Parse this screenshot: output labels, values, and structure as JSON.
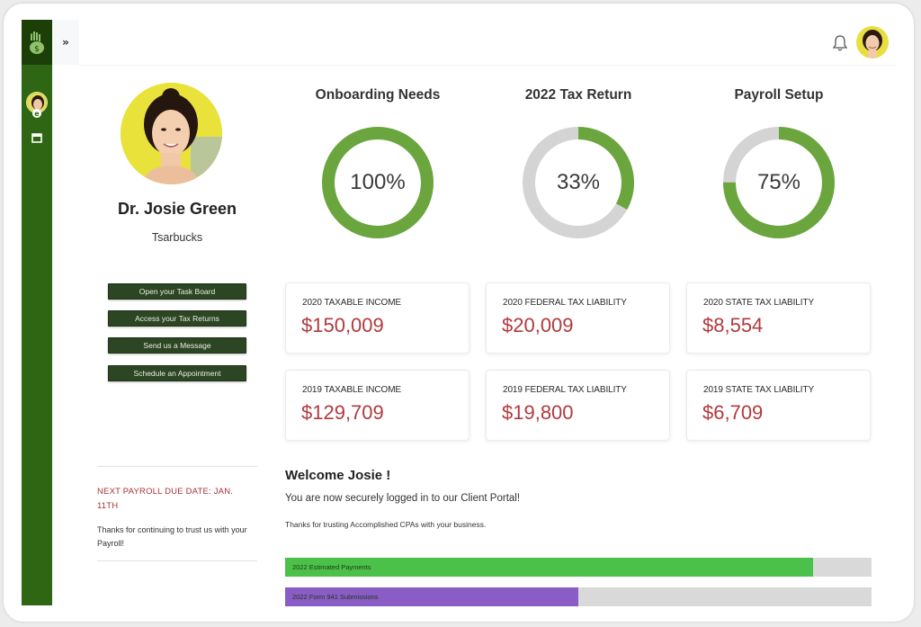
{
  "colors": {
    "rail": "#2f6614",
    "accent_green": "#6aa63d",
    "ring_track": "#d4d4d4",
    "money_red": "#b03a3e",
    "bar_green": "#4cc14a",
    "bar_purple": "#8a5cc6",
    "button": "#2c4522"
  },
  "topbar": {
    "expand_icon": "double-chevron-right-icon",
    "expand_glyph": "»",
    "bell_icon": "bell-icon"
  },
  "profile": {
    "name": "Dr. Josie Green",
    "company": "Tsarbucks"
  },
  "actions": [
    {
      "label": "Open your Task Board"
    },
    {
      "label": "Access your Tax Returns"
    },
    {
      "label": "Send us a Message"
    },
    {
      "label": "Schedule an Appointment"
    }
  ],
  "notice": {
    "due": "NEXT PAYROLL DUE DATE: JAN. 11TH",
    "thanks": "Thanks for continuing to trust us with your Payroll!"
  },
  "progress_rings": [
    {
      "title": "Onboarding Needs",
      "value_text": "100%",
      "fraction": 1.0
    },
    {
      "title": "2022 Tax Return",
      "value_text": "33%",
      "fraction": 0.33
    },
    {
      "title": "Payroll Setup",
      "value_text": "75%",
      "fraction": 0.75
    }
  ],
  "cards": [
    {
      "label": "2020 TAXABLE INCOME",
      "amount": "$150,009"
    },
    {
      "label": "2020 FEDERAL TAX LIABILITY",
      "amount": "$20,009"
    },
    {
      "label": "2020 STATE TAX LIABILITY",
      "amount": "$8,554"
    },
    {
      "label": "2019 TAXABLE INCOME",
      "amount": "$129,709"
    },
    {
      "label": "2019 FEDERAL TAX LIABILITY",
      "amount": "$19,800"
    },
    {
      "label": "2019 STATE TAX LIABILITY",
      "amount": "$6,709"
    }
  ],
  "welcome": {
    "title": "Welcome Josie !",
    "line1": "You are now securely logged in to our Client Portal!",
    "line2": "Thanks for trusting Accomplished CPAs with your business."
  },
  "progress_bars": [
    {
      "label": "2022 Estimated Payments",
      "fraction": 0.9
    },
    {
      "label": "2022 Form 941 Submissions",
      "fraction": 0.5
    }
  ]
}
